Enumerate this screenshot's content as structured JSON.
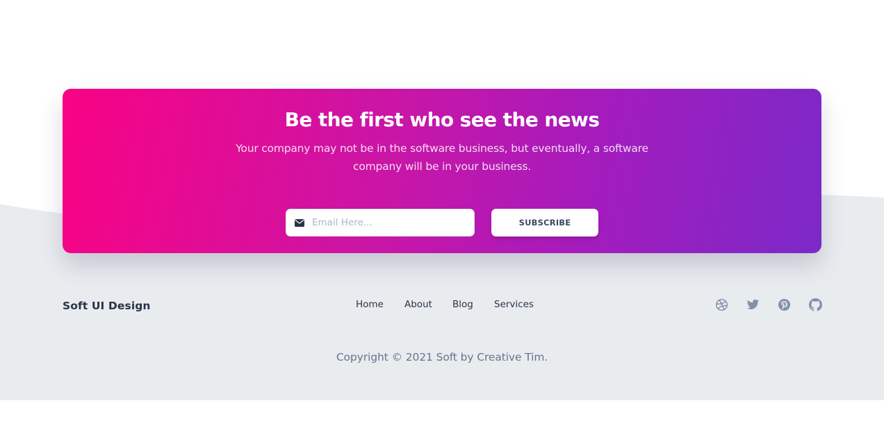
{
  "colors": {
    "gradient_start": "#f90384",
    "gradient_end": "#7c29c8",
    "footer_background": "#e9ecef",
    "text_dark": "#2a3347",
    "text_muted": "#67748e",
    "social_icon": "#8392ab"
  },
  "newsletter": {
    "title": "Be the first who see the news",
    "subtitle": "Your company may not be in the software business, but eventually, a software company will be in your business.",
    "email_icon": "envelope-icon",
    "email_placeholder": "Email Here...",
    "email_value": "",
    "subscribe_label": "SUBSCRIBE"
  },
  "footer": {
    "brand": "Soft UI Design",
    "nav": [
      {
        "label": "Home"
      },
      {
        "label": "About"
      },
      {
        "label": "Blog"
      },
      {
        "label": "Services"
      }
    ],
    "social": [
      {
        "icon": "dribbble-icon"
      },
      {
        "icon": "twitter-icon"
      },
      {
        "icon": "pinterest-icon"
      },
      {
        "icon": "github-icon"
      }
    ],
    "copyright": "Copyright © 2021 Soft by Creative Tim."
  }
}
